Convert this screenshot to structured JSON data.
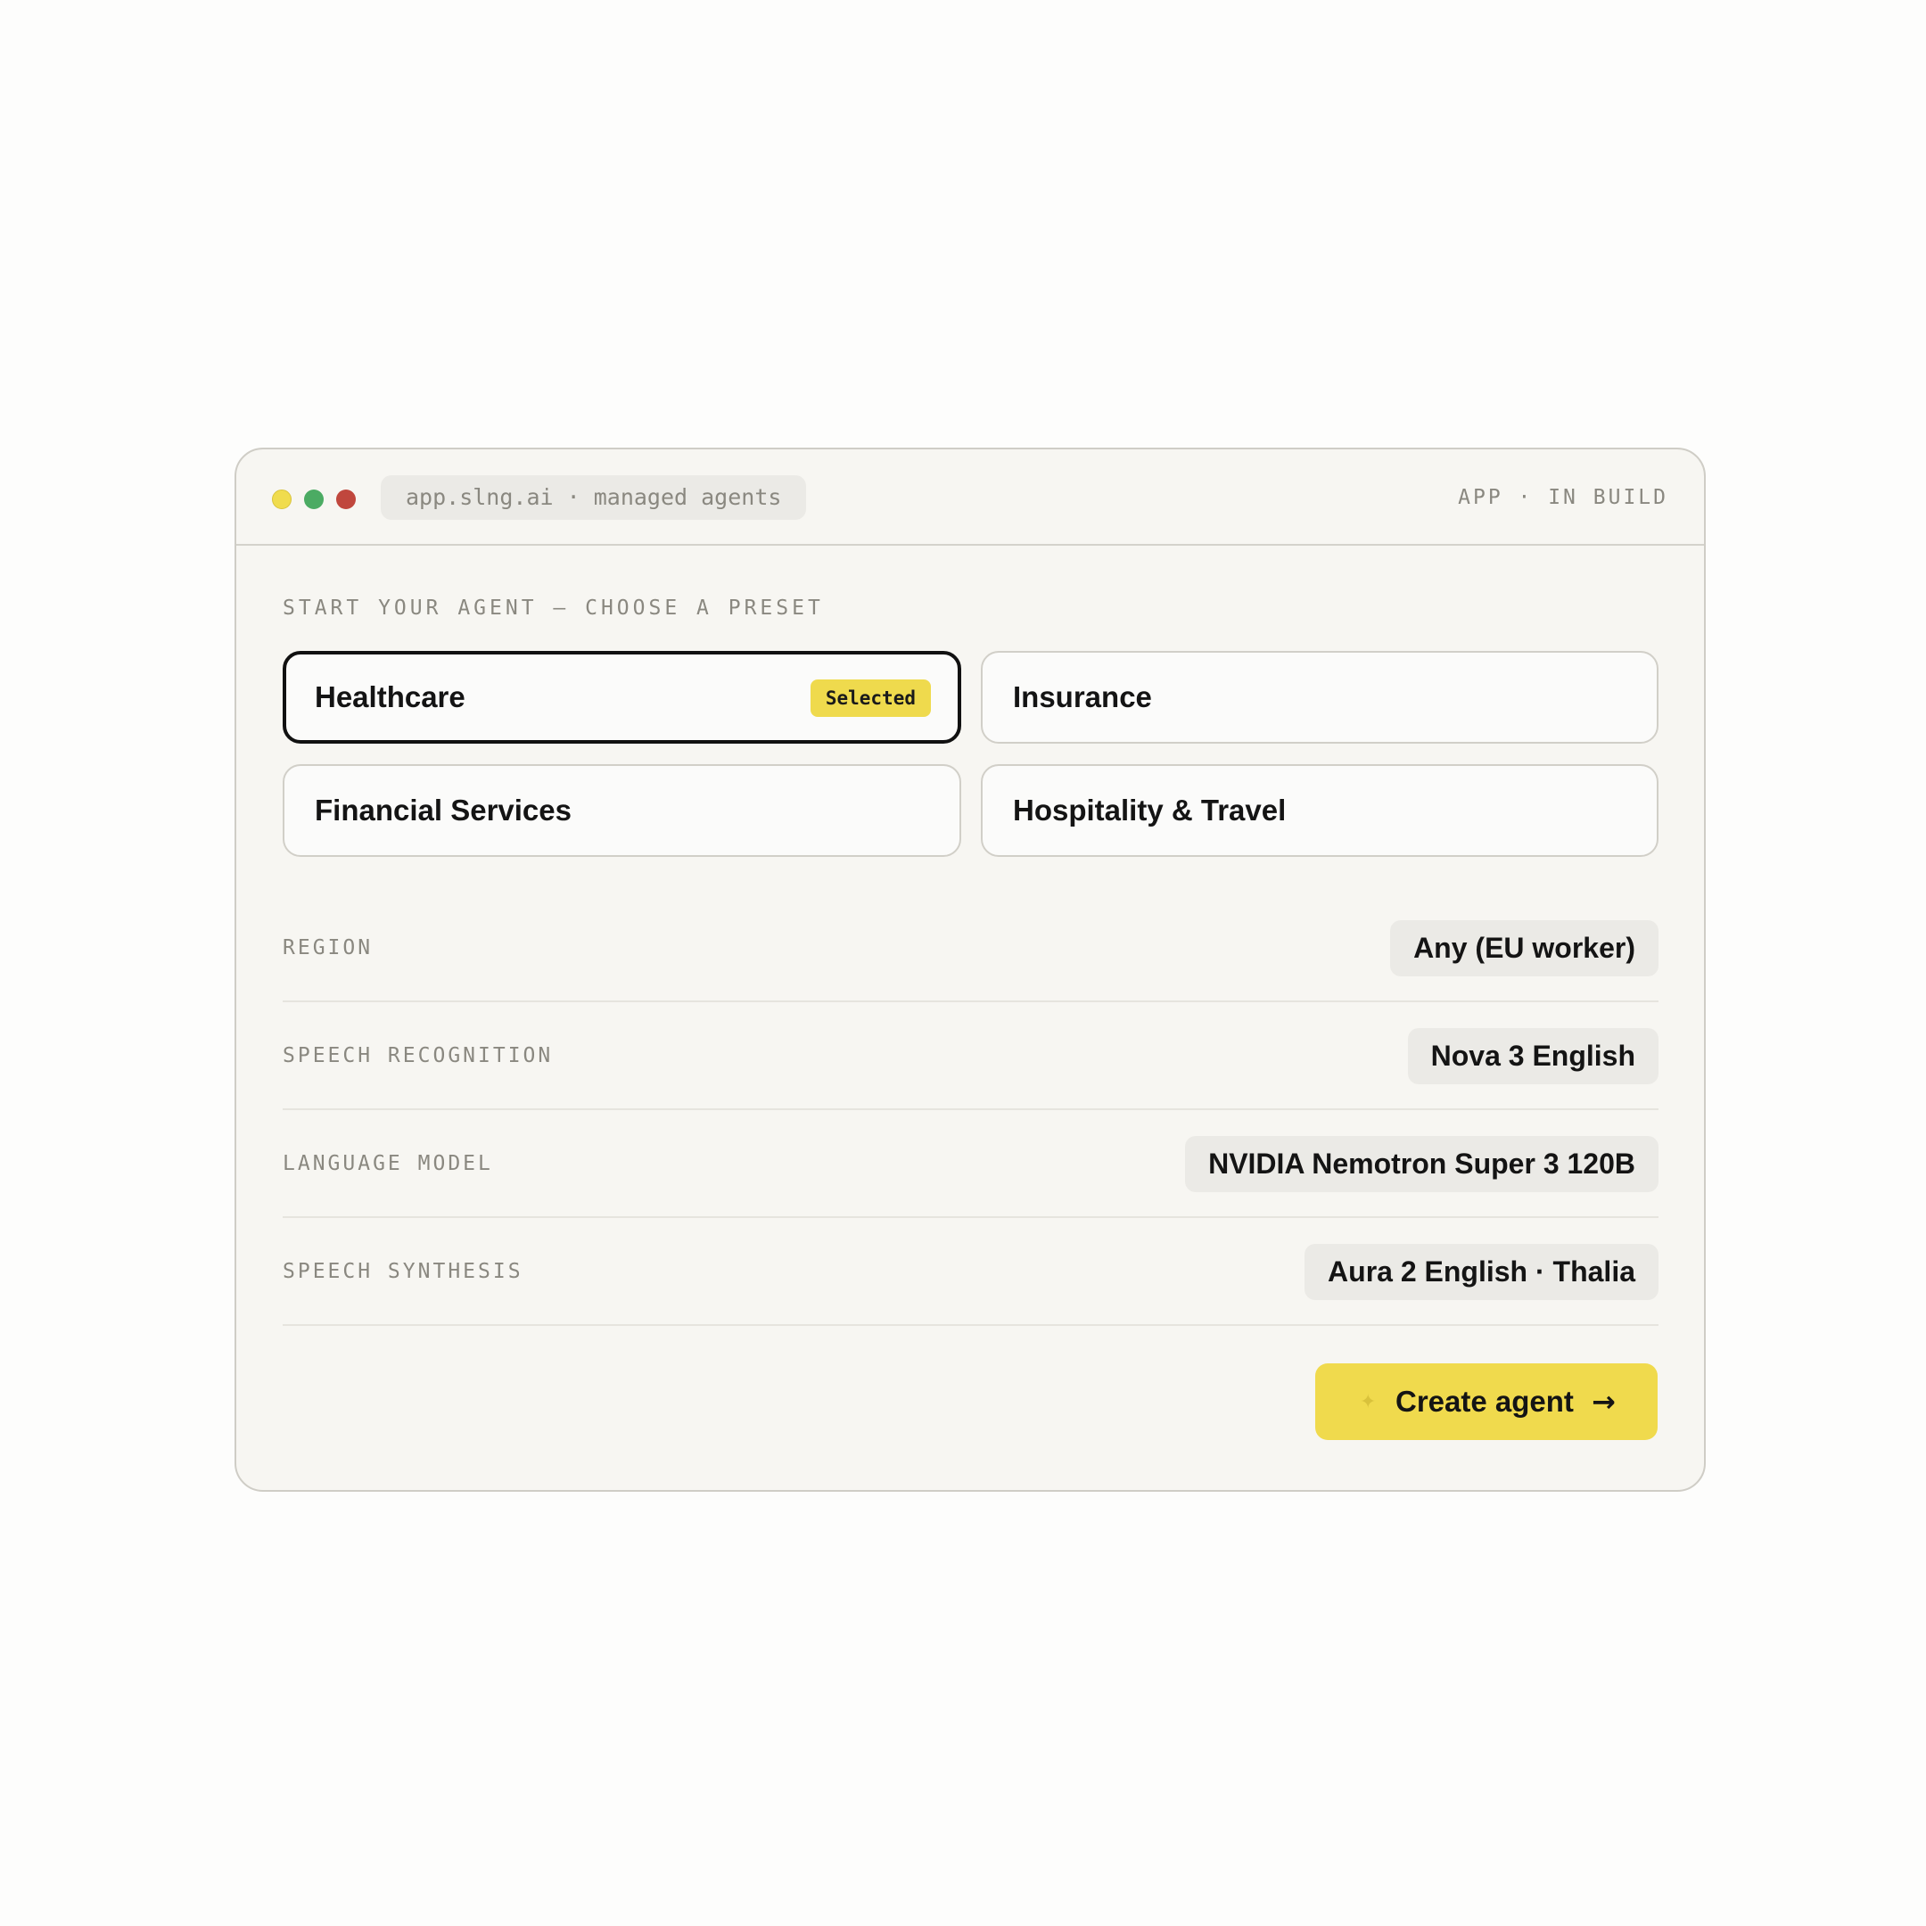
{
  "window": {
    "url": "app.slng.ai · managed agents",
    "status": "APP · IN BUILD",
    "controls": {
      "yellow": "#f0dc4e",
      "green": "#4bab63",
      "red": "#c0473d"
    }
  },
  "presets": {
    "label": "START YOUR AGENT — CHOOSE A PRESET",
    "items": [
      {
        "name": "Healthcare",
        "selected": true,
        "badge": "Selected"
      },
      {
        "name": "Insurance",
        "selected": false
      },
      {
        "name": "Financial Services",
        "selected": false
      },
      {
        "name": "Hospitality & Travel",
        "selected": false
      }
    ]
  },
  "config": {
    "rows": [
      {
        "label": "REGION",
        "value": "Any (EU worker)"
      },
      {
        "label": "SPEECH RECOGNITION",
        "value": "Nova 3 English"
      },
      {
        "label": "LANGUAGE MODEL",
        "value": "NVIDIA Nemotron Super 3 120B"
      },
      {
        "label": "SPEECH SYNTHESIS",
        "value": "Aura 2 English · Thalia"
      }
    ]
  },
  "actions": {
    "create_label": "Create agent",
    "create_icon": "arrow-right-icon",
    "spark_icon": "sparkle-icon"
  },
  "colors": {
    "accent": "#f0da4d",
    "background": "#f7f6f2",
    "text": "#141414",
    "muted": "#8a8880"
  }
}
